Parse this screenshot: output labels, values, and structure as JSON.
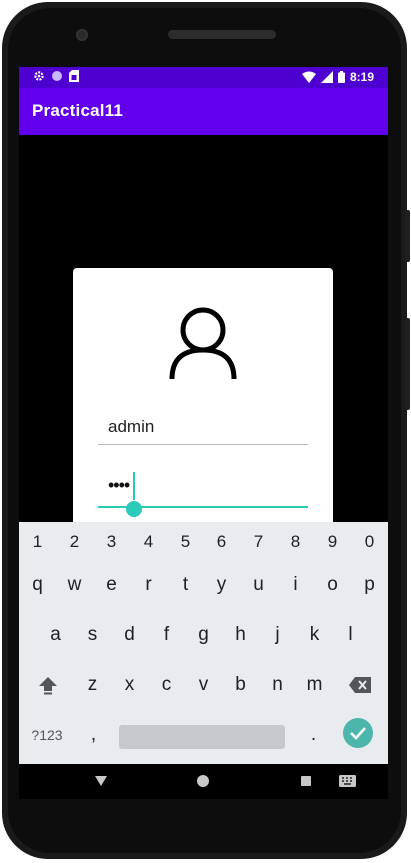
{
  "status_bar": {
    "time": "8:19",
    "left_icons": [
      "settings-icon",
      "circle-icon",
      "sim-card-icon"
    ],
    "right_icons": [
      "wifi-icon",
      "signal-icon",
      "battery-icon"
    ],
    "color": "#4e00d1"
  },
  "app_bar": {
    "title": "Practical11",
    "color": "#6200ee"
  },
  "login_card": {
    "icon": "user-icon",
    "username_value": "admin",
    "password_masked": "••••",
    "accent_color": "#2ccbb9"
  },
  "keyboard": {
    "number_row": [
      "1",
      "2",
      "3",
      "4",
      "5",
      "6",
      "7",
      "8",
      "9",
      "0"
    ],
    "row1": [
      "q",
      "w",
      "e",
      "r",
      "t",
      "y",
      "u",
      "i",
      "o",
      "p"
    ],
    "row2": [
      "a",
      "s",
      "d",
      "f",
      "g",
      "h",
      "j",
      "k",
      "l"
    ],
    "row3": [
      "z",
      "x",
      "c",
      "v",
      "b",
      "n",
      "m"
    ],
    "symbols_label": "?123",
    "comma_label": ",",
    "period_label": ".",
    "shift_icon": "shift-icon",
    "backspace_icon": "backspace-icon",
    "done_icon": "check-icon"
  },
  "nav_bar": {
    "icons": [
      "back-icon",
      "home-icon",
      "recents-icon",
      "keyboard-switch-icon"
    ]
  }
}
